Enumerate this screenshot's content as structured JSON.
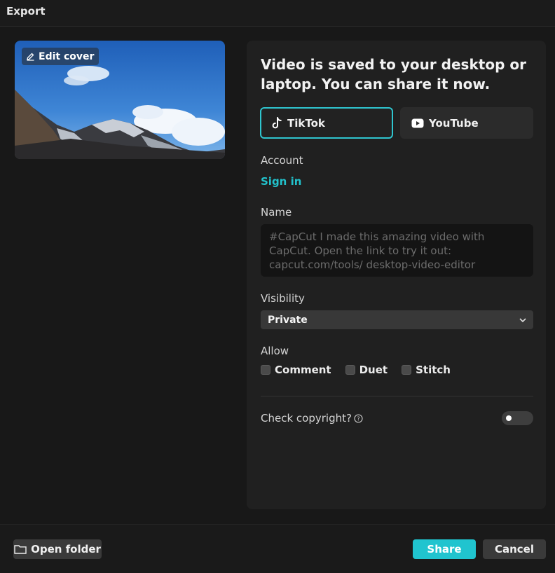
{
  "window": {
    "title": "Export"
  },
  "cover": {
    "edit_label": "Edit cover"
  },
  "panel": {
    "headline": "Video is saved to your desktop or laptop. You can share it now.",
    "tabs": [
      {
        "label": "TikTok",
        "icon": "tiktok-icon",
        "active": true
      },
      {
        "label": "YouTube",
        "icon": "youtube-icon",
        "active": false
      }
    ],
    "account": {
      "label": "Account",
      "sign_in": "Sign in"
    },
    "name": {
      "label": "Name",
      "placeholder": "#CapCut I made this amazing video with CapCut. Open the link to try it out: capcut.com/tools/ desktop-video-editor"
    },
    "visibility": {
      "label": "Visibility",
      "value": "Private"
    },
    "allow": {
      "label": "Allow",
      "options": [
        {
          "label": "Comment",
          "checked": false
        },
        {
          "label": "Duet",
          "checked": false
        },
        {
          "label": "Stitch",
          "checked": false
        }
      ]
    },
    "copyright": {
      "label": "Check copyright?",
      "enabled": false
    }
  },
  "footer": {
    "open_folder": "Open folder",
    "share": "Share",
    "cancel": "Cancel"
  },
  "colors": {
    "accent": "#20c4cf",
    "background": "#181818",
    "panel": "#202020"
  }
}
